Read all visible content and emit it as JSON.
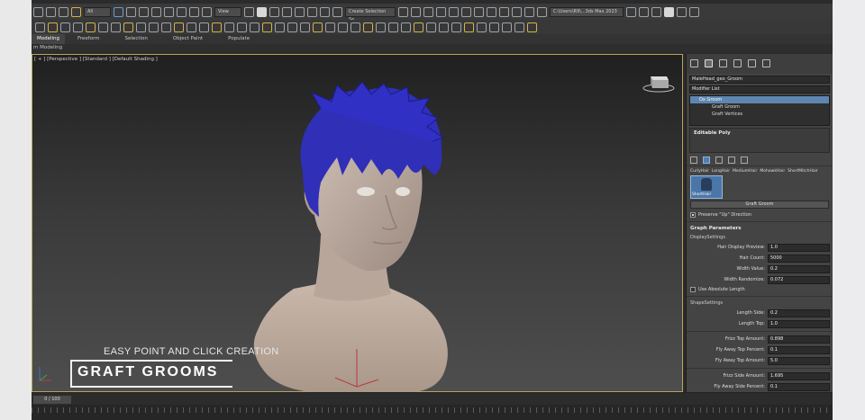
{
  "toolbar": {
    "selection_filter": "All",
    "reference_coord": "View",
    "selection_set": "Create Selection Se",
    "project_path": "C:\\Users\\R9\\...3ds Max 2023"
  },
  "ribbon": {
    "tabs": [
      "Modeling",
      "Freeform",
      "Selection",
      "Object Paint",
      "Populate"
    ],
    "subtitle": "m Modeling"
  },
  "viewport": {
    "label": "[ + ] [Perspective ] [Standard ] [Default Shading ]",
    "overlay_subtitle": "EASY POINT AND CLICK CREATION",
    "overlay_title": "GRAFT GROOMS"
  },
  "timeline": {
    "frame": "0 / 100"
  },
  "command_panel": {
    "object_name": "MaleHead_geo_Groom",
    "modifier_list": "Modifier List",
    "stack": [
      "Ox Groom",
      "Graft Groom",
      "Graft Vertices"
    ],
    "editable_poly": "Editable Poly",
    "presets": [
      "CurlyHair",
      "LongHair",
      "MediumHair",
      "MohawkHair",
      "ShortMitchHair"
    ],
    "selected_preset": "ShortHair",
    "graft_button": "Graft Groom",
    "preserve_up": "Preserve \"Up\" Direction",
    "graph_params": "Graph Parameters",
    "display_group": "DisplaySettings",
    "display_rows": [
      {
        "label": "Hair Display Preview:",
        "value": "1.0"
      },
      {
        "label": "Hair Count:",
        "value": "5000"
      },
      {
        "label": "Width Value:",
        "value": "0.2"
      },
      {
        "label": "Width Randomize:",
        "value": "0.072"
      }
    ],
    "use_absolute_length": "Use Absolute Length",
    "shape_group": "ShapeSettings",
    "shape_rows": [
      {
        "label": "Length Side:",
        "value": "0.2"
      },
      {
        "label": "Length Top:",
        "value": "1.0"
      }
    ],
    "frizz_rows": [
      {
        "label": "Frizz Top Amount:",
        "value": "0.898"
      },
      {
        "label": "Fly Away Top Percent:",
        "value": "0.1"
      },
      {
        "label": "Fly Away Top Amount:",
        "value": "5.0"
      }
    ],
    "frizz_side_rows": [
      {
        "label": "Frizz Side Amount:",
        "value": "1.695"
      },
      {
        "label": "Fly Away Side Percent:",
        "value": "0.1"
      }
    ]
  }
}
